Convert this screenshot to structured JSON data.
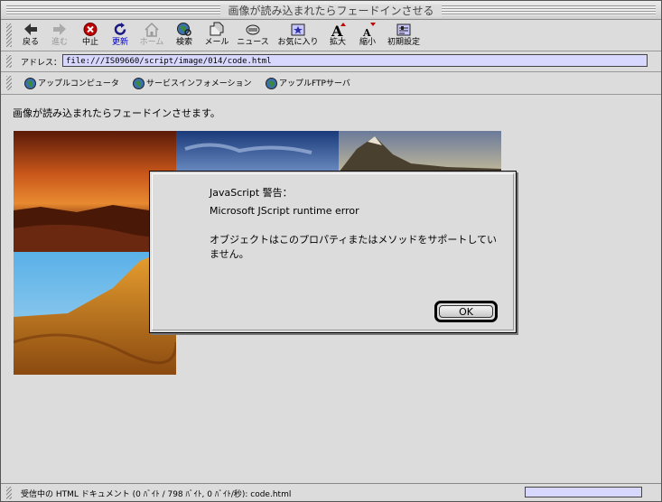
{
  "window": {
    "title": "画像が読み込まれたらフェードインさせる"
  },
  "toolbar": {
    "buttons": [
      {
        "label": "戻る",
        "icon": "back-arrow-icon"
      },
      {
        "label": "進む",
        "icon": "forward-arrow-icon",
        "disabled": true
      },
      {
        "label": "中止",
        "icon": "stop-icon"
      },
      {
        "label": "更新",
        "icon": "reload-icon"
      },
      {
        "label": "ホーム",
        "icon": "home-icon",
        "disabled": true
      },
      {
        "label": "検索",
        "icon": "search-globe-icon"
      },
      {
        "label": "メール",
        "icon": "mail-icon"
      },
      {
        "label": "ニュース",
        "icon": "news-icon"
      },
      {
        "label": "お気に入り",
        "icon": "favorites-icon"
      },
      {
        "label": "拡大",
        "icon": "text-larger-icon"
      },
      {
        "label": "縮小",
        "icon": "text-smaller-icon"
      },
      {
        "label": "初期設定",
        "icon": "preferences-icon"
      }
    ]
  },
  "address": {
    "label": "アドレス：",
    "value": "file:///IS09660/script/image/014/code.html"
  },
  "links": [
    {
      "label": "アップルコンピュータ"
    },
    {
      "label": "サービスインフォメーション"
    },
    {
      "label": "アップルFTPサーバ"
    }
  ],
  "page": {
    "heading": "画像が読み込まれたらフェードインさせます。"
  },
  "dialog": {
    "title_line": "JavaScript 警告：",
    "error_line": "Microsoft JScript runtime error",
    "message": "オブジェクトはこのプロパティまたはメソッドをサポートしていません。",
    "ok_label": "OK"
  },
  "status": {
    "text": "受信中の HTML ドキュメント (0 ﾊﾞｲﾄ / 798 ﾊﾞｲﾄ, 0 ﾊﾞｲﾄ/秒): code.html"
  },
  "colors": {
    "field_bg": "#d8d8ff",
    "link_blue": "#0000c0",
    "stop_red": "#c00000"
  }
}
